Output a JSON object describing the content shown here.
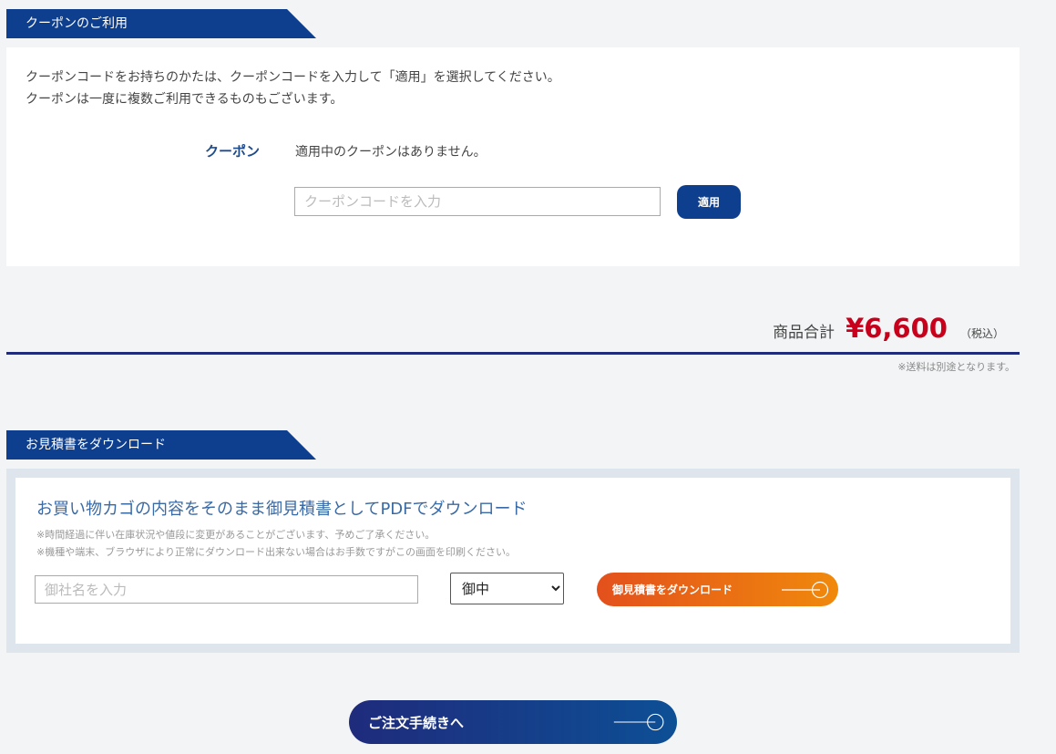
{
  "coupon_section": {
    "heading": "クーポンのご利用",
    "desc_line1": "クーポンコードをお持ちのかたは、クーポンコードを入力して「適用」を選択してください。",
    "desc_line2": "クーポンは一度に複数ご利用できるものもございます。",
    "label": "クーポン",
    "status": "適用中のクーポンはありません。",
    "input_placeholder": "クーポンコードを入力",
    "input_value": "",
    "apply_button": "適用"
  },
  "total": {
    "label": "商品合計",
    "amount": "¥6,600",
    "tax_label": "（税込）",
    "shipping_note": "※送料は別途となります。"
  },
  "estimate_section": {
    "heading": "お見積書をダウンロード",
    "title": "お買い物カゴの内容をそのまま御見積書としてPDFでダウンロード",
    "note1": "※時間経過に伴い在庫状況や値段に変更があることがございます、予めご了承ください。",
    "note2": "※機種や端末、ブラウザにより正常にダウンロード出来ない場合はお手数ですがこの画面を印刷ください。",
    "company_placeholder": "御社名を入力",
    "company_value": "",
    "honorific_selected": "御中",
    "download_button": "御見積書をダウンロード"
  },
  "order_button": "ご注文手続きへ",
  "colors": {
    "navy": "#0d3f8e",
    "price_red": "#c9001c",
    "orange_start": "#e3501c",
    "orange_end": "#f0890c",
    "page_bg": "#f2f4f5"
  },
  "icons": {
    "download_arrow": "circle-arrow-icon",
    "order_arrow": "circle-arrow-icon"
  }
}
